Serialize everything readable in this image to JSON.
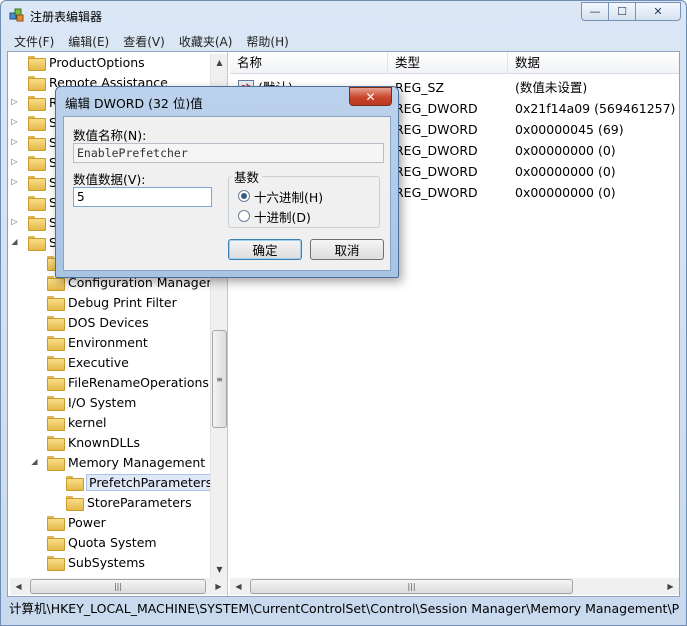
{
  "window": {
    "title": "注册表编辑器",
    "caption_min": "—",
    "caption_max": "☐",
    "caption_close": "✕"
  },
  "menu": [
    "文件(F)",
    "编辑(E)",
    "查看(V)",
    "收藏夹(A)",
    "帮助(H)"
  ],
  "tree": [
    {
      "label": "ProductOptions",
      "indent": 0,
      "expander": ""
    },
    {
      "label": "Remote Assistance",
      "indent": 0,
      "expander": ""
    },
    {
      "label": "R",
      "indent": 0,
      "expander": "▷"
    },
    {
      "label": "S",
      "indent": 0,
      "expander": "▷"
    },
    {
      "label": "S",
      "indent": 0,
      "expander": "▷"
    },
    {
      "label": "S",
      "indent": 0,
      "expander": "▷"
    },
    {
      "label": "S",
      "indent": 0,
      "expander": "▷"
    },
    {
      "label": "S",
      "indent": 0,
      "expander": ""
    },
    {
      "label": "S",
      "indent": 0,
      "expander": "▷"
    },
    {
      "label": "S",
      "indent": 0,
      "expander": "◢"
    },
    {
      "label": "",
      "indent": 1,
      "expander": ""
    },
    {
      "label": "Configuration Manager",
      "indent": 1,
      "expander": ""
    },
    {
      "label": "Debug Print Filter",
      "indent": 1,
      "expander": ""
    },
    {
      "label": "DOS Devices",
      "indent": 1,
      "expander": ""
    },
    {
      "label": "Environment",
      "indent": 1,
      "expander": ""
    },
    {
      "label": "Executive",
      "indent": 1,
      "expander": ""
    },
    {
      "label": "FileRenameOperations",
      "indent": 1,
      "expander": ""
    },
    {
      "label": "I/O System",
      "indent": 1,
      "expander": ""
    },
    {
      "label": "kernel",
      "indent": 1,
      "expander": ""
    },
    {
      "label": "KnownDLLs",
      "indent": 1,
      "expander": ""
    },
    {
      "label": "Memory Management",
      "indent": 1,
      "expander": "◢"
    },
    {
      "label": "PrefetchParameters",
      "indent": 2,
      "expander": "",
      "selected": true
    },
    {
      "label": "StoreParameters",
      "indent": 2,
      "expander": ""
    },
    {
      "label": "Power",
      "indent": 1,
      "expander": ""
    },
    {
      "label": "Quota System",
      "indent": 1,
      "expander": ""
    },
    {
      "label": "SubSystems",
      "indent": 1,
      "expander": ""
    }
  ],
  "list": {
    "headers": [
      "名称",
      "类型",
      "数据"
    ],
    "rows": [
      {
        "name": "(默认)",
        "type": "REG_SZ",
        "data": "(数值未设置)",
        "icon": "ab"
      },
      {
        "name": "",
        "type": "REG_DWORD",
        "data": "0x21f14a09 (569461257)",
        "icon": "011"
      },
      {
        "name": "",
        "type": "REG_DWORD",
        "data": "0x00000045 (69)",
        "icon": "011"
      },
      {
        "name": "",
        "type": "REG_DWORD",
        "data": "0x00000000 (0)",
        "icon": "011"
      },
      {
        "name": "",
        "type": "REG_DWORD",
        "data": "0x00000000 (0)",
        "icon": "011"
      },
      {
        "name": "",
        "type": "REG_DWORD",
        "data": "0x00000000 (0)",
        "icon": "011"
      }
    ]
  },
  "status": "计算机\\HKEY_LOCAL_MACHINE\\SYSTEM\\CurrentControlSet\\Control\\Session Manager\\Memory Management\\Pre",
  "dialog": {
    "title": "编辑 DWORD (32 位)值",
    "close": "✕",
    "name_label": "数值名称(N):",
    "name_value": "EnablePrefetcher",
    "data_label": "数值数据(V):",
    "data_value": "5",
    "base_label": "基数",
    "radio_hex": "十六进制(H)",
    "radio_dec": "十进制(D)",
    "selected_base": "hex",
    "ok": "确定",
    "cancel": "取消"
  },
  "scroll": {
    "up": "▲",
    "down": "▼",
    "left": "◀",
    "right": "▶",
    "grip": "≡",
    "hgrip": "|||"
  }
}
